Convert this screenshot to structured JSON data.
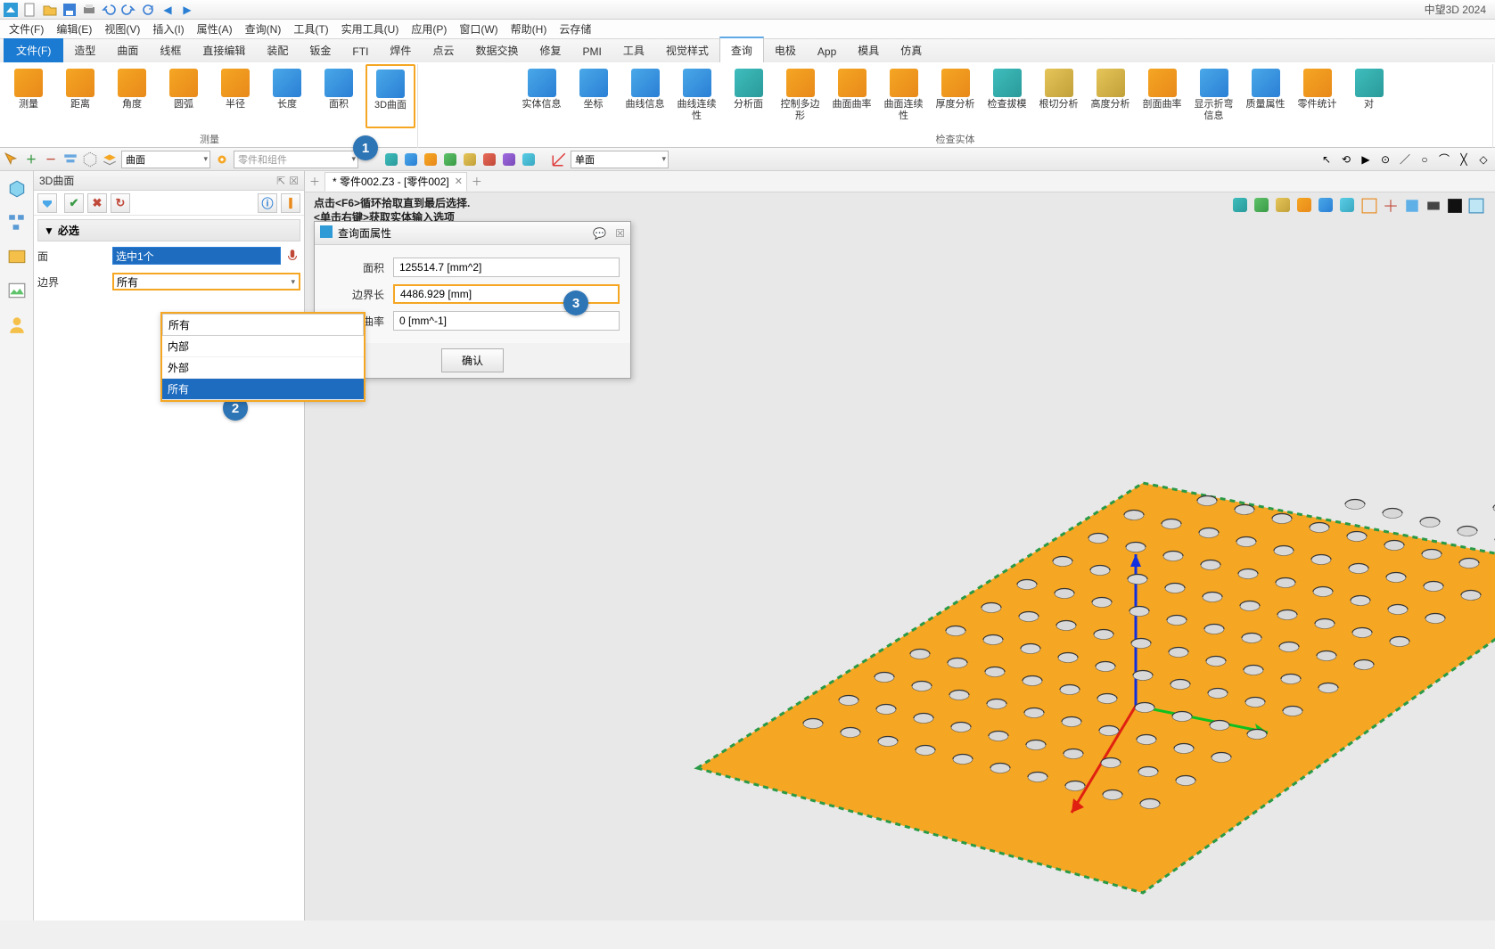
{
  "app_title": "中望3D 2024",
  "menubar": {
    "items": [
      "文件(F)",
      "编辑(E)",
      "视图(V)",
      "插入(I)",
      "属性(A)",
      "查询(N)",
      "工具(T)",
      "实用工具(U)",
      "应用(P)",
      "窗口(W)",
      "帮助(H)",
      "云存储"
    ]
  },
  "ribbontabs": {
    "file": "文件(F)",
    "items": [
      "造型",
      "曲面",
      "线框",
      "直接编辑",
      "装配",
      "钣金",
      "FTI",
      "焊件",
      "点云",
      "数据交换",
      "修复",
      "PMI",
      "工具",
      "视觉样式",
      "查询",
      "电极",
      "App",
      "模具",
      "仿真"
    ],
    "active": "查询"
  },
  "ribbon": {
    "group_measure": {
      "label": "测量",
      "buttons": [
        "测量",
        "距离",
        "角度",
        "圆弧",
        "半径",
        "长度",
        "面积",
        "3D曲面"
      ]
    },
    "group_inspect": {
      "label": "检查实体",
      "buttons": [
        "实体信息",
        "坐标",
        "曲线信息",
        "曲线连续性",
        "分析面",
        "控制多边形",
        "曲面曲率",
        "曲面连续性",
        "厚度分析",
        "检查拔模",
        "根切分析",
        "高度分析",
        "剖面曲率",
        "显示折弯信息",
        "质量属性",
        "零件统计",
        "对"
      ]
    }
  },
  "toolbar2": {
    "dd1": "曲面",
    "dd2": "零件和组件",
    "dd3": "单面"
  },
  "panel": {
    "title": "3D曲面",
    "section": "必选",
    "face_label": "面",
    "face_value": "选中1个",
    "boundary_label": "边界",
    "boundary_value": "所有",
    "dropdown_options": [
      "内部",
      "外部",
      "所有"
    ],
    "dropdown_selected": "所有"
  },
  "document_tab": "* 零件002.Z3 - [零件002]",
  "viewport_hint_l1": "点击<F6>循环拾取直到最后选择.",
  "viewport_hint_l2": "<单击右键>获取实体输入选项",
  "float_window": {
    "title": "查询面属性",
    "rows": [
      {
        "label": "面积",
        "value": "125514.7  [mm^2]"
      },
      {
        "label": "边界长",
        "value": "4486.929  [mm]"
      },
      {
        "label": "最大曲率",
        "value": "0  [mm^-1]"
      }
    ],
    "ok": "确认"
  },
  "callouts": {
    "c1": "1",
    "c2": "2",
    "c3": "3"
  }
}
